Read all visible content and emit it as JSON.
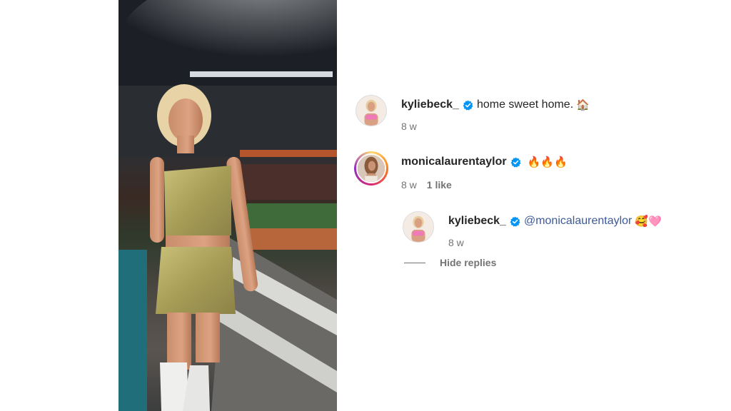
{
  "post": {
    "image_alt": "",
    "comments": [
      {
        "username": "kyliebeck_",
        "text": "home sweet home.",
        "emoji": "🏠",
        "time": "8 w"
      },
      {
        "username": "monicalaurentaylor",
        "emoji": "🔥🔥🔥",
        "time": "8 w",
        "likes": "1 like",
        "replies": [
          {
            "username": "kyliebeck_",
            "mention": "@monicalaurentaylor",
            "emoji": "🥰🩷",
            "time": "8 w"
          }
        ]
      }
    ],
    "hide_replies_label": "Hide replies"
  },
  "colors": {
    "verified": "#0095f6",
    "mention": "#3d5a98",
    "meta": "#737373"
  }
}
